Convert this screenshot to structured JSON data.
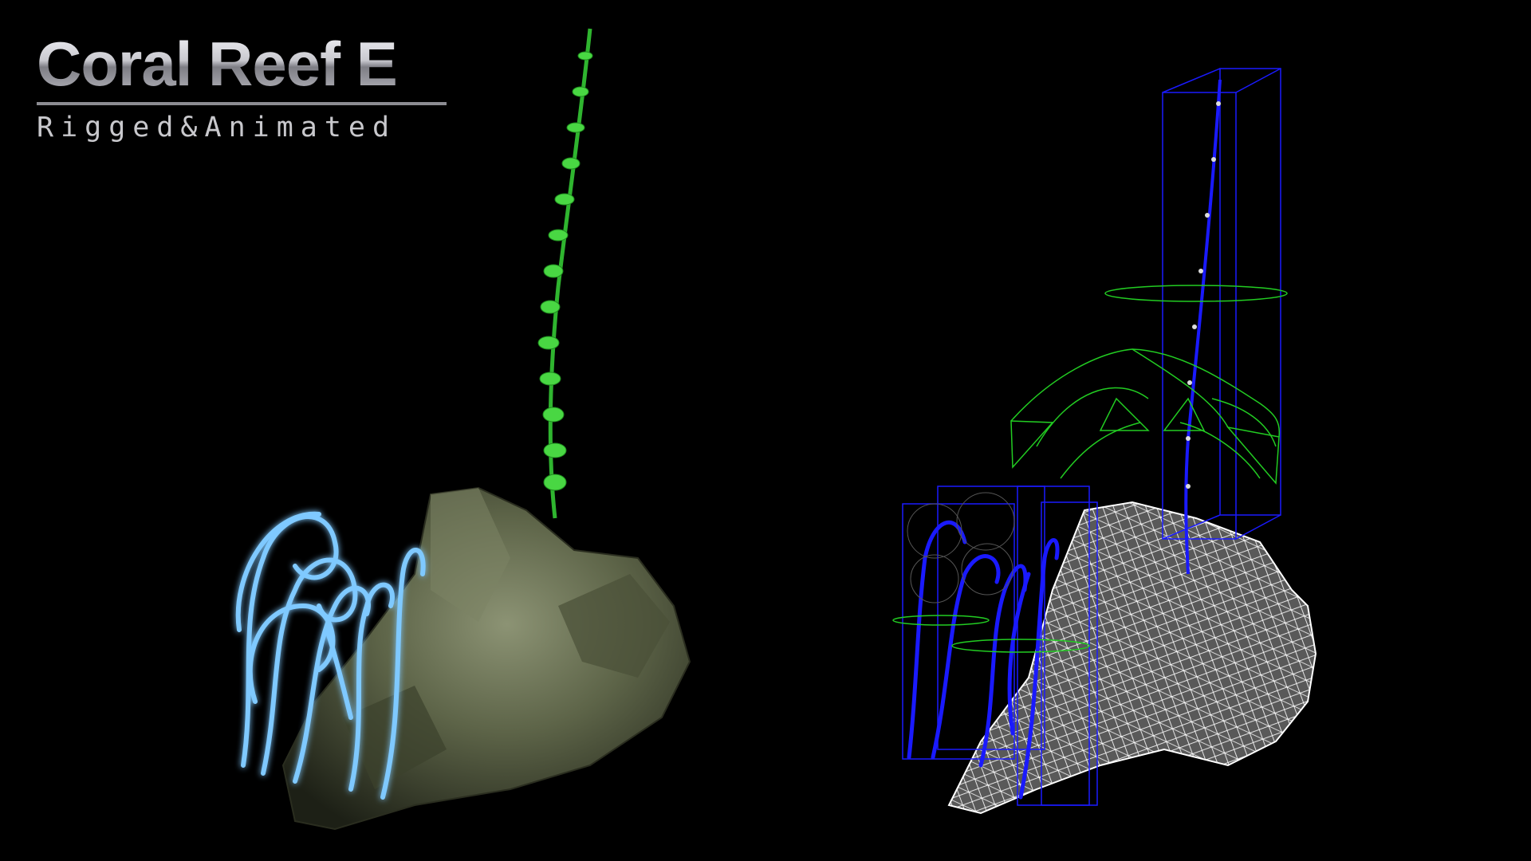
{
  "title": {
    "main": "Coral Reef E",
    "subtitle": "Rigged&Animated"
  },
  "colors": {
    "background": "#000000",
    "title": "#cfcfd4",
    "rock": "#5d6448",
    "seaweed": "#3fcf3a",
    "tendril": "#7fc9ff",
    "bones": "#1a1aff",
    "controls": "#22cc22",
    "wireframe": "#ffffff"
  },
  "icons": {
    "rendered_model": "rendered-coral-icon",
    "wireframe_model": "wireframe-rig-icon"
  }
}
